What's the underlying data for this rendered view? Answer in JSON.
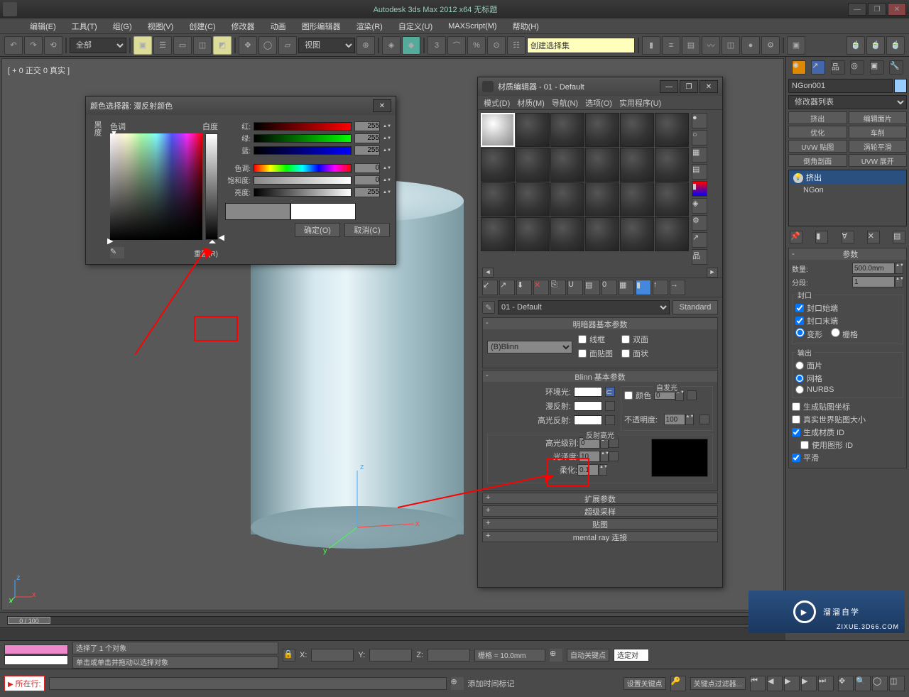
{
  "app": {
    "title": "Autodesk 3ds Max  2012 x64    无标题",
    "viewport_label": "[ + 0 正交 0 真实 ]"
  },
  "menubar": [
    "编辑(E)",
    "工具(T)",
    "组(G)",
    "视图(V)",
    "创建(C)",
    "修改器",
    "动画",
    "图形编辑器",
    "渲染(R)",
    "自定义(U)",
    "MAXScript(M)",
    "帮助(H)"
  ],
  "toolbar": {
    "filter": "全部",
    "view": "视图",
    "selectset": "创建选择集"
  },
  "color_dialog": {
    "title": "颜色选择器: 漫反射颜色",
    "hue_label": "色调",
    "whiteness_label": "白度",
    "blackness_label": "黑度",
    "channels": {
      "red": {
        "label": "红:",
        "value": "255"
      },
      "green": {
        "label": "绿:",
        "value": "255"
      },
      "blue": {
        "label": "蓝:",
        "value": "255"
      },
      "hue": {
        "label": "色调:",
        "value": "0"
      },
      "sat": {
        "label": "饱和度:",
        "value": "0"
      },
      "val": {
        "label": "亮度:",
        "value": "255"
      }
    },
    "reset": "重置(R)",
    "ok": "确定(O)",
    "cancel": "取消(C)"
  },
  "material_editor": {
    "title": "材质编辑器 - 01 - Default",
    "menubar": [
      "模式(D)",
      "材质(M)",
      "导航(N)",
      "选项(O)",
      "实用程序(U)"
    ],
    "material_name": "01 - Default",
    "type_button": "Standard",
    "rollouts": {
      "shader_basic": {
        "title": "明暗器基本参数",
        "shader": "(B)Blinn",
        "wire": "线框",
        "two_sided": "双面",
        "face_map": "面贴图",
        "faceted": "面状"
      },
      "blinn_basic": {
        "title": "Blinn 基本参数",
        "ambient": "环境光:",
        "diffuse": "漫反射:",
        "specular": "高光反射:",
        "self_illum_group": "自发光",
        "self_illum_color": "颜色",
        "self_illum_value": "0",
        "opacity_label": "不透明度:",
        "opacity_value": "100",
        "highlights_group": "反射高光",
        "spec_level_label": "高光级别:",
        "spec_level_value": "0",
        "gloss_label": "光泽度:",
        "gloss_value": "10",
        "soften_label": "柔化:",
        "soften_value": "0.1"
      },
      "collapsed": [
        "扩展参数",
        "超级采样",
        "贴图",
        "mental ray 连接"
      ]
    }
  },
  "right_panel": {
    "object_name": "NGon001",
    "modifier_list": "修改器列表",
    "buttons": [
      "挤出",
      "编辑面片",
      "优化",
      "车削",
      "UVW 贴图",
      "涡轮平滑",
      "倒角剖面",
      "UVW 展开"
    ],
    "stack": [
      "挤出",
      "NGon"
    ],
    "params": {
      "title": "参数",
      "amount_label": "数量:",
      "amount_value": "500.0mm",
      "segments_label": "分段:",
      "segments_value": "1",
      "capping_group": "封口",
      "cap_start": "封口始端",
      "cap_end": "封口末端",
      "morph": "变形",
      "grid": "栅格",
      "output_group": "输出",
      "patch": "面片",
      "mesh": "网格",
      "nurbs": "NURBS",
      "gen_map": "生成贴图坐标",
      "real_world": "真实世界贴图大小",
      "gen_mat": "生成材质 ID",
      "use_shape": "使用图形 ID",
      "smooth": "平滑"
    }
  },
  "timeline": {
    "frame": "0 / 100"
  },
  "status": {
    "selected": "选择了 1 个对象",
    "hint": "单击或单击并拖动以选择对象",
    "grid": "栅格 = 10.0mm",
    "autokey": "自动关键点",
    "selected_obj": "选定对",
    "setkey": "设置关键点",
    "keyfilter": "关键点过滤器...",
    "addtime": "添加时间标记",
    "prompt": "所在行:",
    "x": "X:",
    "y": "Y:",
    "z": "Z:"
  },
  "watermark": {
    "main": "溜溜自学",
    "sub": "ZIXUE.3D66.COM"
  }
}
